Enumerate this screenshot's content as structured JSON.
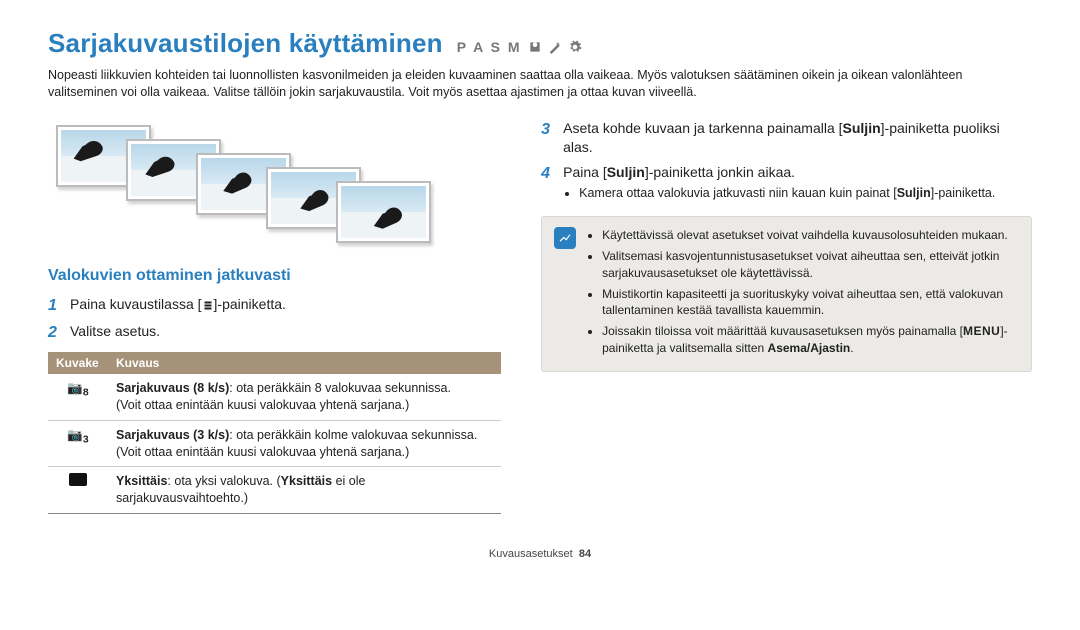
{
  "title": "Sarjakuvaustilojen käyttäminen",
  "modes_text": "P A S M",
  "intro": "Nopeasti liikkuvien kohteiden tai luonnollisten kasvonilmeiden ja eleiden kuvaaminen saattaa olla vaikeaa. Myös valotuksen säätäminen oikein ja oikean valonlähteen valitseminen voi olla vaikeaa. Valitse tällöin jokin sarjakuvaustila. Voit myös asettaa ajastimen ja ottaa kuvan viiveellä.",
  "subhead": "Valokuvien ottaminen jatkuvasti",
  "steps_left": [
    {
      "n": "1",
      "before": "Paina kuvaustilassa [",
      "after": "]-painiketta."
    },
    {
      "n": "2",
      "text": "Valitse asetus."
    }
  ],
  "table": {
    "head_icon": "Kuvake",
    "head_desc": "Kuvaus",
    "rows": [
      {
        "icon_text": "8",
        "bold": "Sarjakuvaus (8 k/s)",
        "rest": ": ota peräkkäin 8 valokuvaa sekunnissa.",
        "paren": "(Voit ottaa enintään kuusi valokuvaa yhtenä sarjana.)"
      },
      {
        "icon_text": "3",
        "bold": "Sarjakuvaus (3 k/s)",
        "rest": ": ota peräkkäin kolme valokuvaa sekunnissa.",
        "paren": "(Voit ottaa enintään kuusi valokuvaa yhtenä sarjana.)"
      },
      {
        "icon_box": true,
        "bold": "Yksittäis",
        "rest": ": ota yksi valokuva. (",
        "bold2": "Yksittäis",
        "rest2": " ei ole sarjakuvausvaihtoehto.)"
      }
    ]
  },
  "steps_right": [
    {
      "n": "3",
      "parts": {
        "a": "Aseta kohde kuvaan ja tarkenna painamalla [",
        "b": "Suljin",
        "c": "]-painiketta puoliksi alas."
      }
    },
    {
      "n": "4",
      "parts": {
        "a": "Paina [",
        "b": "Suljin",
        "c": "]-painiketta jonkin aikaa."
      },
      "sub": {
        "a": "Kamera ottaa valokuvia jatkuvasti niin kauan kuin painat [",
        "b": "Suljin",
        "c": "]-painiketta."
      }
    }
  ],
  "info": {
    "items": [
      "Käytettävissä olevat asetukset voivat vaihdella kuvausolosuhteiden mukaan.",
      "Valitsemasi kasvojentunnistusasetukset voivat aiheuttaa sen, etteivät jotkin sarjakuvausasetukset ole käytettävissä.",
      "Muistikortin kapasiteetti ja suorituskyky voivat aiheuttaa sen, että valokuvan tallentaminen kestää tavallista kauemmin."
    ],
    "last": {
      "a": "Joissakin tiloissa voit määrittää kuvausasetuksen myös painamalla [",
      "menu": "MENU",
      "b": "]-painiketta ja valitsemalla sitten ",
      "bold": "Asema/Ajastin",
      "c": "."
    }
  },
  "footer": {
    "label": "Kuvausasetukset",
    "page": "84"
  }
}
